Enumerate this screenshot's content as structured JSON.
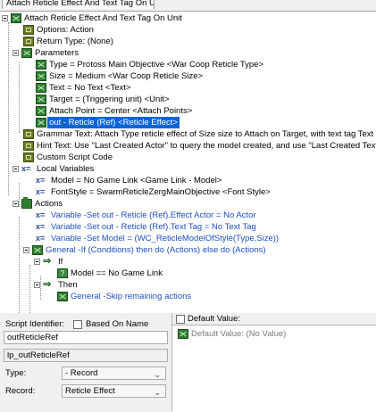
{
  "tab": {
    "label": "Attach Reticle Effect And Text Tag On Unit"
  },
  "tree": {
    "root": "Attach Reticle Effect And Text Tag On Unit",
    "options": "Options: Action",
    "return_type": "Return Type: (None)",
    "parameters": {
      "label": "Parameters",
      "items": [
        "Type = Protoss Main Objective <War Coop Reticle Type>",
        "Size = Medium <War Coop Reticle Size>",
        "Text = No Text <Text>",
        "Target = (Triggering unit) <Unit>",
        "Attach Point = Center <Attach Points>",
        "out - Reticle (Ref) <Reticle Effect>"
      ]
    },
    "grammar_text": "Grammar Text: Attach Type reticle effect of Size size to Attach on Target, with text tag Text",
    "hint_text": "Hint Text: Use \"Last Created Actor\" to query the model created, and use \"Last Created Text Tag\" for the",
    "custom_script": "Custom Script Code",
    "local_variables": {
      "label": "Local Variables",
      "items": [
        "Model = No Game Link <Game Link - Model>",
        "FontStyle = SwarmReticleZergMainObjective <Font Style>"
      ]
    },
    "actions": {
      "label": "Actions",
      "items": [
        "Variable -Set out - Reticle (Ref).Effect Actor = No Actor",
        "Variable -Set out - Reticle (Ref).Text Tag = No Text Tag",
        "Variable -Set Model = (WC_ReticleModelOfStyle(Type,Size))",
        "General -If (Conditions) then do (Actions) else do (Actions)"
      ],
      "if_label": "If",
      "condition": "Model == No Game Link",
      "then_label": "Then",
      "then_action": "General -Skip remaining actions"
    }
  },
  "script_panel": {
    "identifier_label": "Script Identifier:",
    "based_on_name_label": "Based On Name",
    "identifier_value": "outReticleRef",
    "script_name": "lp_outReticleRef",
    "type_label": "Type:",
    "type_value": "- Record",
    "record_label": "Record:",
    "record_value": "Reticle Effect"
  },
  "default_panel": {
    "label": "Default Value:",
    "value": "Default Value: (No Value)"
  },
  "colors": {
    "selection": "#0a64d8",
    "blue_text": "#1f4fbf",
    "icon_green": "#2f7d2f"
  }
}
